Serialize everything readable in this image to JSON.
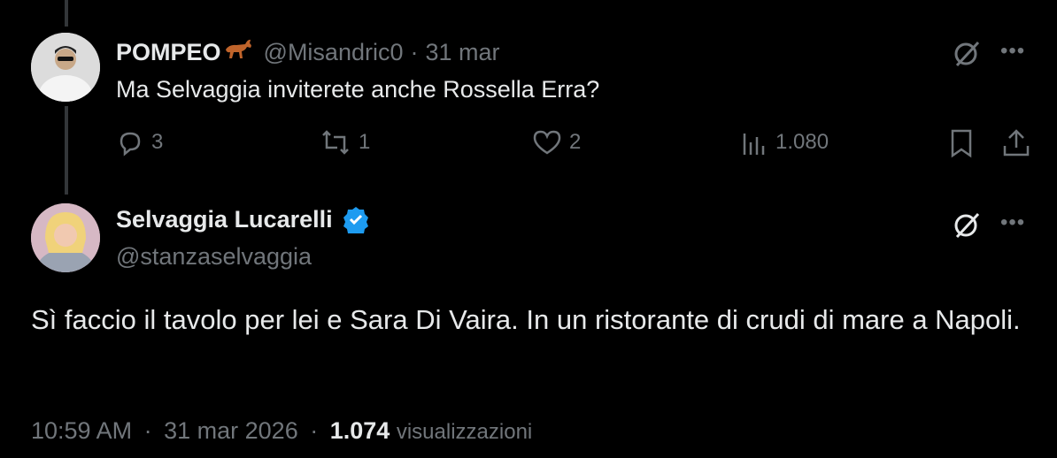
{
  "reply": {
    "display_name": "POMPEO",
    "handle": "@Misandric0",
    "separator": "·",
    "date": "31 mar",
    "text": "Ma Selvaggia inviterete anche Rossella Erra?",
    "replies": "3",
    "reposts": "1",
    "likes": "2",
    "views": "1.080"
  },
  "post": {
    "display_name": "Selvaggia Lucarelli",
    "handle": "@stanzaselvaggia",
    "text": "Sì faccio il tavolo per lei e Sara Di Vaira. In un ristorante di crudi di mare a Napoli.",
    "time": "10:59 AM",
    "separator": "·",
    "date": "31 mar 2026",
    "views_count": "1.074",
    "views_label": "visualizzazioni"
  },
  "icons": {
    "horse": "horse-emoji-icon",
    "verified": "verified-badge-icon",
    "grok": "grok-icon",
    "more": "more-icon",
    "reply": "reply-icon",
    "repost": "repost-icon",
    "like": "like-icon",
    "views": "views-icon",
    "bookmark": "bookmark-icon",
    "share": "share-icon"
  },
  "colors": {
    "background": "#000000",
    "text": "#e7e9ea",
    "muted": "#71767b",
    "verified": "#1d9bf0"
  }
}
